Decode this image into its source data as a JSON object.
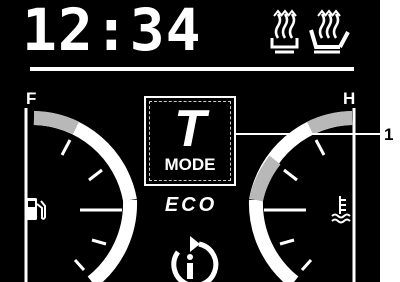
{
  "clock": {
    "time": "12:34"
  },
  "status_icons": [
    "rear-defroster-icon",
    "seat-heater-icon"
  ],
  "fuel_gauge": {
    "top_label": "F",
    "icon": "fuel-pump-icon"
  },
  "temp_gauge": {
    "top_label": "H",
    "icon": "coolant-temperature-icon"
  },
  "mode": {
    "letter": "T",
    "label": "MODE"
  },
  "eco": {
    "label": "ECO"
  },
  "callout": {
    "number": "1"
  },
  "bottom_icon": "info-icon",
  "colors": {
    "background": "#000000",
    "foreground": "#ffffff",
    "highlight": "#b8b8b8",
    "page": "#ffffff"
  }
}
